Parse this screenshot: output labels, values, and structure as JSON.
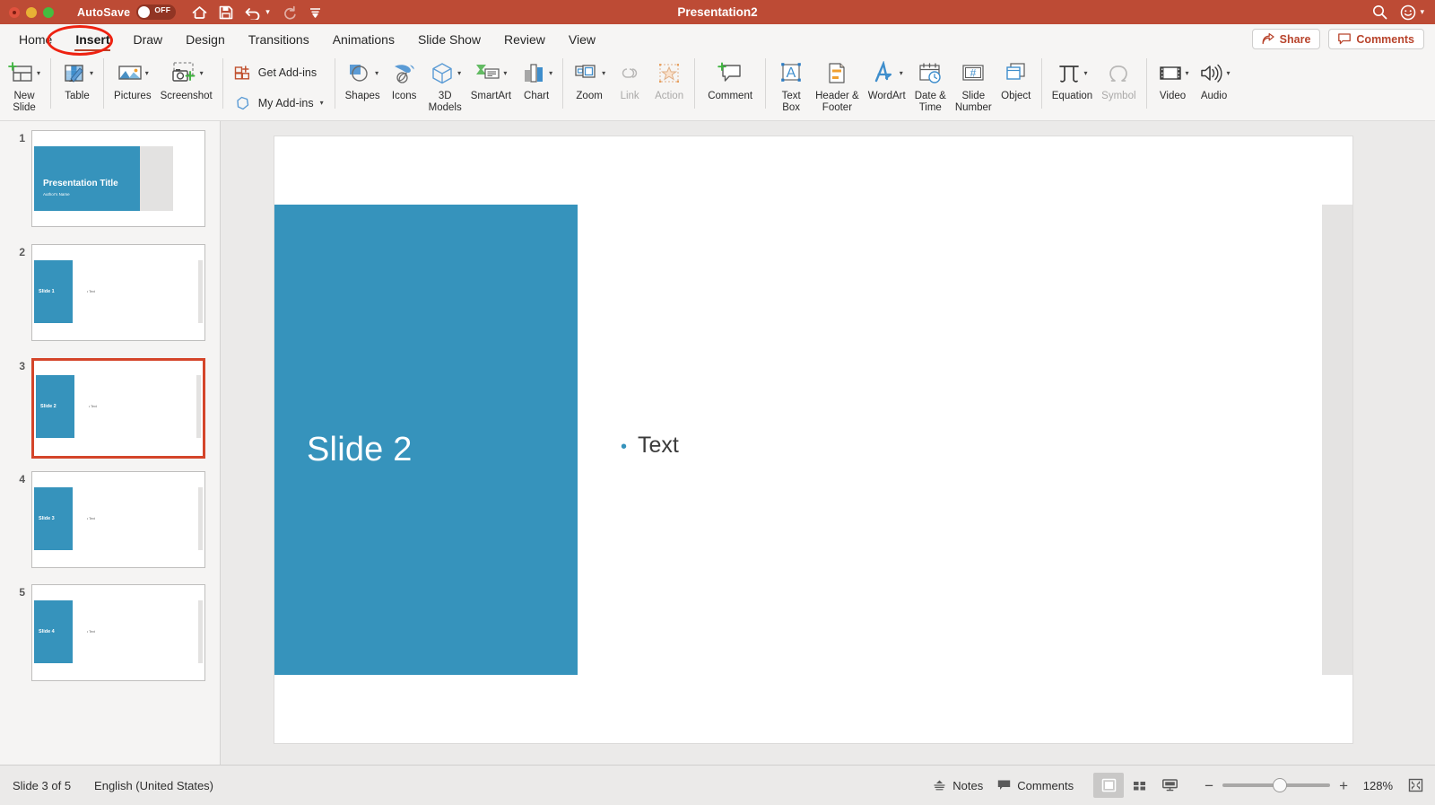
{
  "titlebar": {
    "autosave_label": "AutoSave",
    "autosave_state": "OFF",
    "document_title": "Presentation2",
    "quick_access": [
      "home-icon",
      "save-icon",
      "undo-icon",
      "undo-dropdown-caret",
      "redo-icon",
      "customize-qat-icon"
    ],
    "search_icon": "search-icon",
    "account_icon": "smiley-account-icon"
  },
  "tabs": [
    {
      "label": "Home",
      "active": false
    },
    {
      "label": "Insert",
      "active": true
    },
    {
      "label": "Draw",
      "active": false
    },
    {
      "label": "Design",
      "active": false
    },
    {
      "label": "Transitions",
      "active": false
    },
    {
      "label": "Animations",
      "active": false
    },
    {
      "label": "Slide Show",
      "active": false
    },
    {
      "label": "Review",
      "active": false
    },
    {
      "label": "View",
      "active": false
    }
  ],
  "tab_actions": {
    "share_label": "Share",
    "comments_label": "Comments"
  },
  "ribbon": {
    "groups": [
      {
        "items": [
          {
            "label": "New\nSlide",
            "icon": "new-slide-icon",
            "caret": true,
            "disabled": false
          }
        ]
      },
      {
        "items": [
          {
            "label": "Table",
            "icon": "table-icon",
            "caret": true,
            "disabled": false
          }
        ]
      },
      {
        "items": [
          {
            "label": "Pictures",
            "icon": "pictures-icon",
            "caret": true,
            "disabled": false
          },
          {
            "label": "Screenshot",
            "icon": "screenshot-icon",
            "caret": true,
            "disabled": false
          }
        ]
      },
      {
        "stacked": true,
        "items": [
          {
            "label": "Get Add-ins",
            "icon": "get-addins-icon",
            "caret": false,
            "disabled": false
          },
          {
            "label": "My Add-ins",
            "icon": "my-addins-icon",
            "caret": true,
            "disabled": false
          }
        ]
      },
      {
        "items": [
          {
            "label": "Shapes",
            "icon": "shapes-icon",
            "caret": true,
            "disabled": false
          },
          {
            "label": "Icons",
            "icon": "icons-icon",
            "caret": false,
            "disabled": false
          },
          {
            "label": "3D\nModels",
            "icon": "3d-models-icon",
            "caret": true,
            "disabled": false
          },
          {
            "label": "SmartArt",
            "icon": "smartart-icon",
            "caret": true,
            "disabled": false
          },
          {
            "label": "Chart",
            "icon": "chart-icon",
            "caret": true,
            "disabled": false
          }
        ]
      },
      {
        "items": [
          {
            "label": "Zoom",
            "icon": "zoom-icon",
            "caret": true,
            "disabled": false
          },
          {
            "label": "Link",
            "icon": "link-icon",
            "caret": false,
            "disabled": true
          },
          {
            "label": "Action",
            "icon": "action-icon",
            "caret": false,
            "disabled": true
          }
        ]
      },
      {
        "items": [
          {
            "label": "Comment",
            "icon": "comment-icon",
            "caret": false,
            "disabled": false
          }
        ]
      },
      {
        "items": [
          {
            "label": "Text\nBox",
            "icon": "text-box-icon",
            "caret": false,
            "disabled": false
          },
          {
            "label": "Header &\nFooter",
            "icon": "header-footer-icon",
            "caret": false,
            "disabled": false
          },
          {
            "label": "WordArt",
            "icon": "wordart-icon",
            "caret": true,
            "disabled": false
          },
          {
            "label": "Date &\nTime",
            "icon": "date-time-icon",
            "caret": false,
            "disabled": false
          },
          {
            "label": "Slide\nNumber",
            "icon": "slide-number-icon",
            "caret": false,
            "disabled": false
          },
          {
            "label": "Object",
            "icon": "object-icon",
            "caret": false,
            "disabled": false
          }
        ]
      },
      {
        "items": [
          {
            "label": "Equation",
            "icon": "equation-icon",
            "caret": true,
            "disabled": false
          },
          {
            "label": "Symbol",
            "icon": "symbol-icon",
            "caret": false,
            "disabled": true
          }
        ]
      },
      {
        "items": [
          {
            "label": "Video",
            "icon": "video-icon",
            "caret": true,
            "disabled": false
          },
          {
            "label": "Audio",
            "icon": "audio-icon",
            "caret": true,
            "disabled": false
          }
        ]
      }
    ]
  },
  "slide_panel": {
    "thumbnails": [
      {
        "number": "1",
        "layout": "title",
        "title": "Presentation Title",
        "subtitle": "Author's Name",
        "bullet": "",
        "selected": false
      },
      {
        "number": "2",
        "layout": "content",
        "title": "Slide 1",
        "subtitle": "",
        "bullet": "Text",
        "selected": false
      },
      {
        "number": "3",
        "layout": "content",
        "title": "Slide 2",
        "subtitle": "",
        "bullet": "Text",
        "selected": true
      },
      {
        "number": "4",
        "layout": "content",
        "title": "Slide 3",
        "subtitle": "",
        "bullet": "Text",
        "selected": false
      },
      {
        "number": "5",
        "layout": "content",
        "title": "Slide 4",
        "subtitle": "",
        "bullet": "Text",
        "selected": false
      }
    ]
  },
  "canvas": {
    "slide_title": "Slide 2",
    "slide_bullet": "Text",
    "accent_color": "#3693bc"
  },
  "statusbar": {
    "slide_counter": "Slide 3 of 5",
    "language": "English (United States)",
    "notes_label": "Notes",
    "comments_label": "Comments",
    "zoom_value": "128%",
    "zoom_out_sign": "−",
    "zoom_in_sign": "+",
    "views": [
      "normal-view-icon",
      "slide-sorter-icon",
      "slideshow-view-icon"
    ],
    "fit_icon": "fit-to-window-icon"
  },
  "colors": {
    "titlebar": "#bd4b35",
    "accent_blue": "#3693bc",
    "selection_red": "#d4452a",
    "ribbon_bg": "#f6f5f4"
  }
}
